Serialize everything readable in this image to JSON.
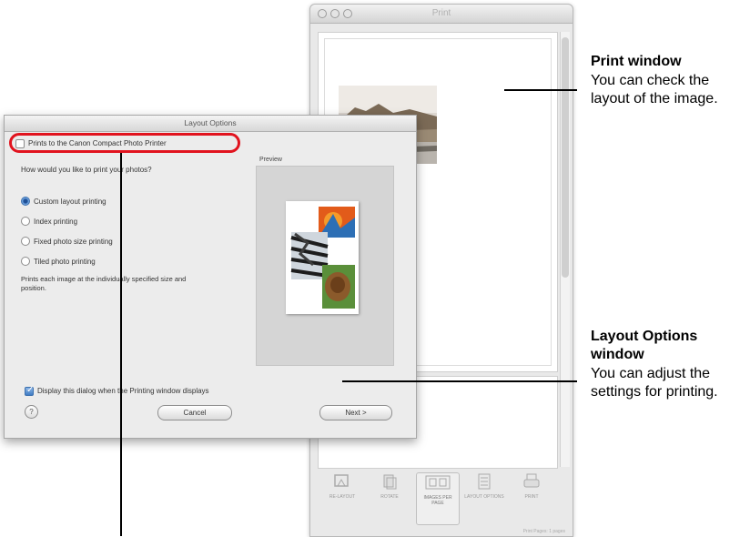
{
  "print_window": {
    "title": "Print",
    "toolbar": [
      {
        "label": "RE-LAYOUT",
        "icon": "relayout-icon"
      },
      {
        "label": "ROTATE",
        "icon": "rotate-icon"
      },
      {
        "label": "IMAGES PER PAGE",
        "icon": "images-per-page-icon"
      },
      {
        "label": "LAYOUT OPTIONS",
        "icon": "layout-options-icon"
      },
      {
        "label": "PRINT",
        "icon": "printer-icon"
      }
    ],
    "status": "Print Pages: 1 pages"
  },
  "layout_dialog": {
    "title": "Layout Options",
    "compact_printer_checkbox": {
      "label": "Prints to the Canon Compact Photo Printer",
      "checked": false
    },
    "question": "How would you like to print your photos?",
    "options": [
      {
        "label": "Custom layout printing",
        "selected": true
      },
      {
        "label": "Index printing",
        "selected": false
      },
      {
        "label": "Fixed photo size printing",
        "selected": false
      },
      {
        "label": "Tiled photo printing",
        "selected": false
      }
    ],
    "description": "Prints each image at the individually specified size and position.",
    "preview_label": "Preview",
    "display_checkbox": {
      "label": "Display this dialog when the Printing window displays",
      "checked": true
    },
    "help_label": "?",
    "cancel_label": "Cancel",
    "next_label": "Next >"
  },
  "callouts": {
    "print_window": {
      "title": "Print window",
      "desc": "You can check the layout of the image."
    },
    "layout_options": {
      "title": "Layout Options window",
      "desc": "You can adjust the settings for printing."
    }
  },
  "colors": {
    "highlight": "#e1131e",
    "accent": "#3f7cc4"
  }
}
